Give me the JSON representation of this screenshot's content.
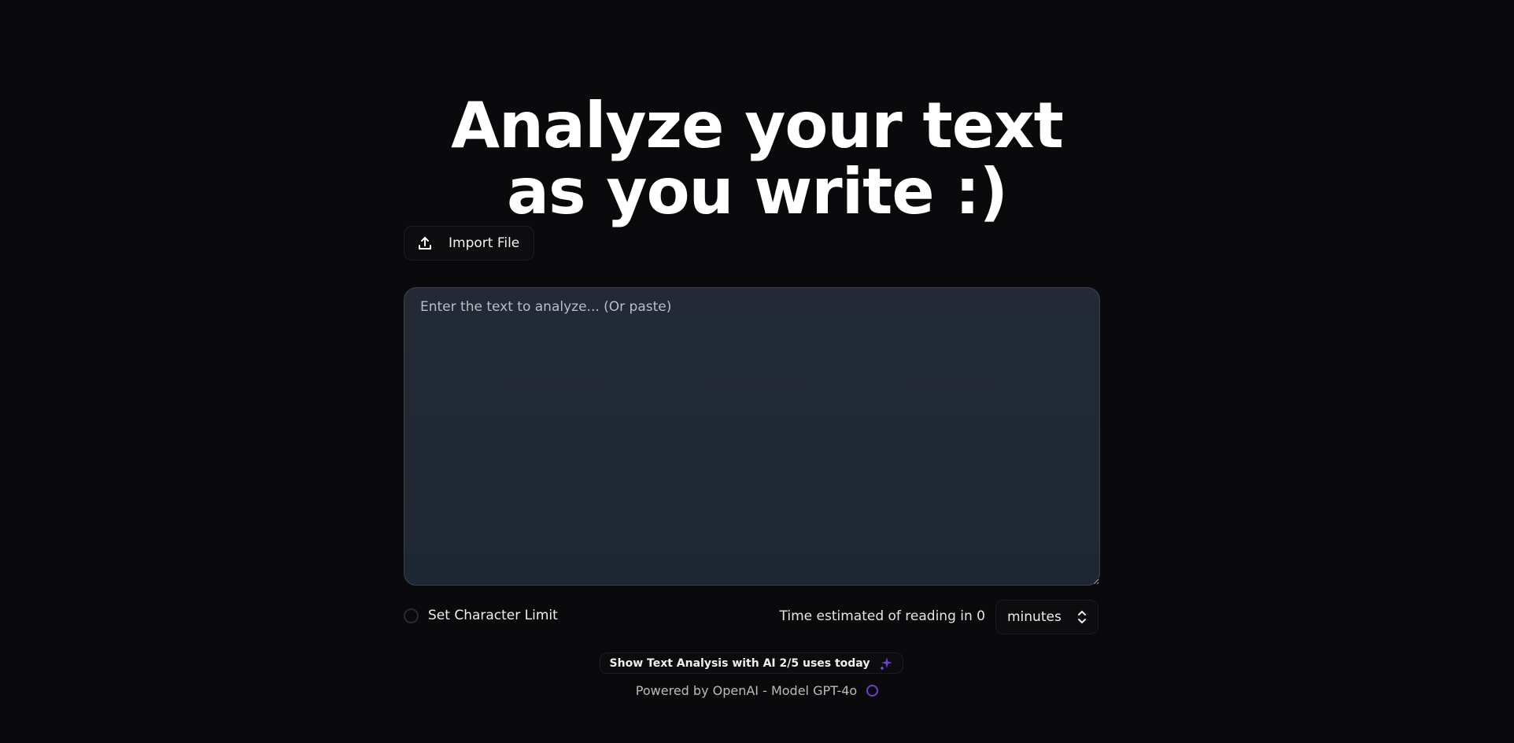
{
  "header": {
    "title_line1": "Analyze your text",
    "title_line2": "as you write :)"
  },
  "import_button": {
    "label": "Import File",
    "icon": "upload-icon"
  },
  "editor": {
    "value": "",
    "placeholder": "Enter the text to analyze... (Or paste)"
  },
  "character_limit": {
    "label": "Set Character Limit",
    "checked": false
  },
  "reading_time": {
    "label": "Time estimated of reading in 0",
    "unit_selected": "minutes"
  },
  "ai_button": {
    "label": "Show Text Analysis with AI 2/5 uses today",
    "icon": "sparkle-icon",
    "accent": "#6d3fd0"
  },
  "footer": {
    "powered_by": "Powered by OpenAI - Model GPT-4o",
    "icon": "openai-icon"
  }
}
